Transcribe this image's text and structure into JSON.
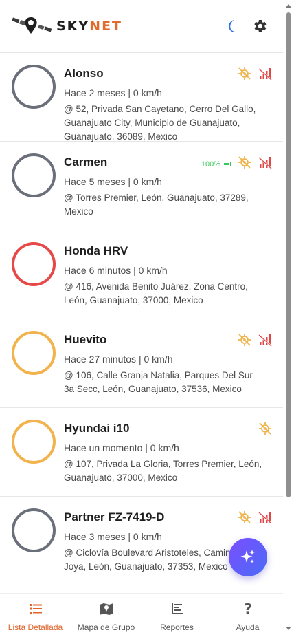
{
  "header": {
    "brand_sky": "SKY",
    "brand_net": "NET",
    "theme_icon": "moon-icon",
    "settings_icon": "gear-icon"
  },
  "colors": {
    "accent": "#e0632a",
    "moon": "#2f6fe0",
    "gear": "#333333",
    "warning": "#f0b44c",
    "danger": "#e04848",
    "battery": "#35c759",
    "fab_start": "#7b4dff",
    "fab_end": "#4a6cf7"
  },
  "vehicles": [
    {
      "name": "Alonso",
      "status": "Hace 2 meses | 0 km/h",
      "address": "@ 52, Privada San Cayetano, Cerro Del Gallo, Guanajuato City, Municipio de Guanajuato, Guanajuato, 36089, Mexico",
      "ring_color": "#6b6f7a",
      "battery": "",
      "gps_off": true,
      "signal_low": true
    },
    {
      "name": "Carmen",
      "status": "Hace 5 meses | 0 km/h",
      "address": "@ Torres Premier, León, Guanajuato, 37289, Mexico",
      "ring_color": "#6b6f7a",
      "battery": "100%",
      "gps_off": true,
      "signal_low": true
    },
    {
      "name": "Honda HRV",
      "status": "Hace 6 minutos | 0 km/h",
      "address": "@ 416, Avenida Benito Juárez, Zona Centro, León, Guanajuato, 37000, Mexico",
      "ring_color": "#e74848",
      "battery": "",
      "gps_off": false,
      "signal_low": false
    },
    {
      "name": "Huevito",
      "status": "Hace 27 minutos | 0 km/h",
      "address": "@ 106, Calle Granja Natalia, Parques Del Sur 3a Secc, León, Guanajuato, 37536, Mexico",
      "ring_color": "#f2b34c",
      "battery": "",
      "gps_off": true,
      "signal_low": true
    },
    {
      "name": "Hyundai i10",
      "status": "Hace un momento | 0 km/h",
      "address": "@ 107, Privada La Gloria, Torres Premier, León, Guanajuato, 37000, Mexico",
      "ring_color": "#f2b34c",
      "battery": "",
      "gps_off": true,
      "signal_low": false
    },
    {
      "name": "Partner FZ-7419-D",
      "status": "Hace 3 meses | 0 km/h",
      "address": "@ Ciclovía Boulevard Aristoteles, Camino De La Joya, León, Guanajuato, 37353, Mexico",
      "ring_color": "#6b6f7a",
      "battery": "",
      "gps_off": true,
      "signal_low": true
    }
  ],
  "fab": {
    "icon": "sparkle-icon"
  },
  "bottom_nav": [
    {
      "label": "Lista Detallada",
      "icon": "list-icon",
      "active": true
    },
    {
      "label": "Mapa de Grupo",
      "icon": "map-icon",
      "active": false
    },
    {
      "label": "Reportes",
      "icon": "chart-icon",
      "active": false
    },
    {
      "label": "Ayuda",
      "icon": "help-icon",
      "active": false
    }
  ]
}
